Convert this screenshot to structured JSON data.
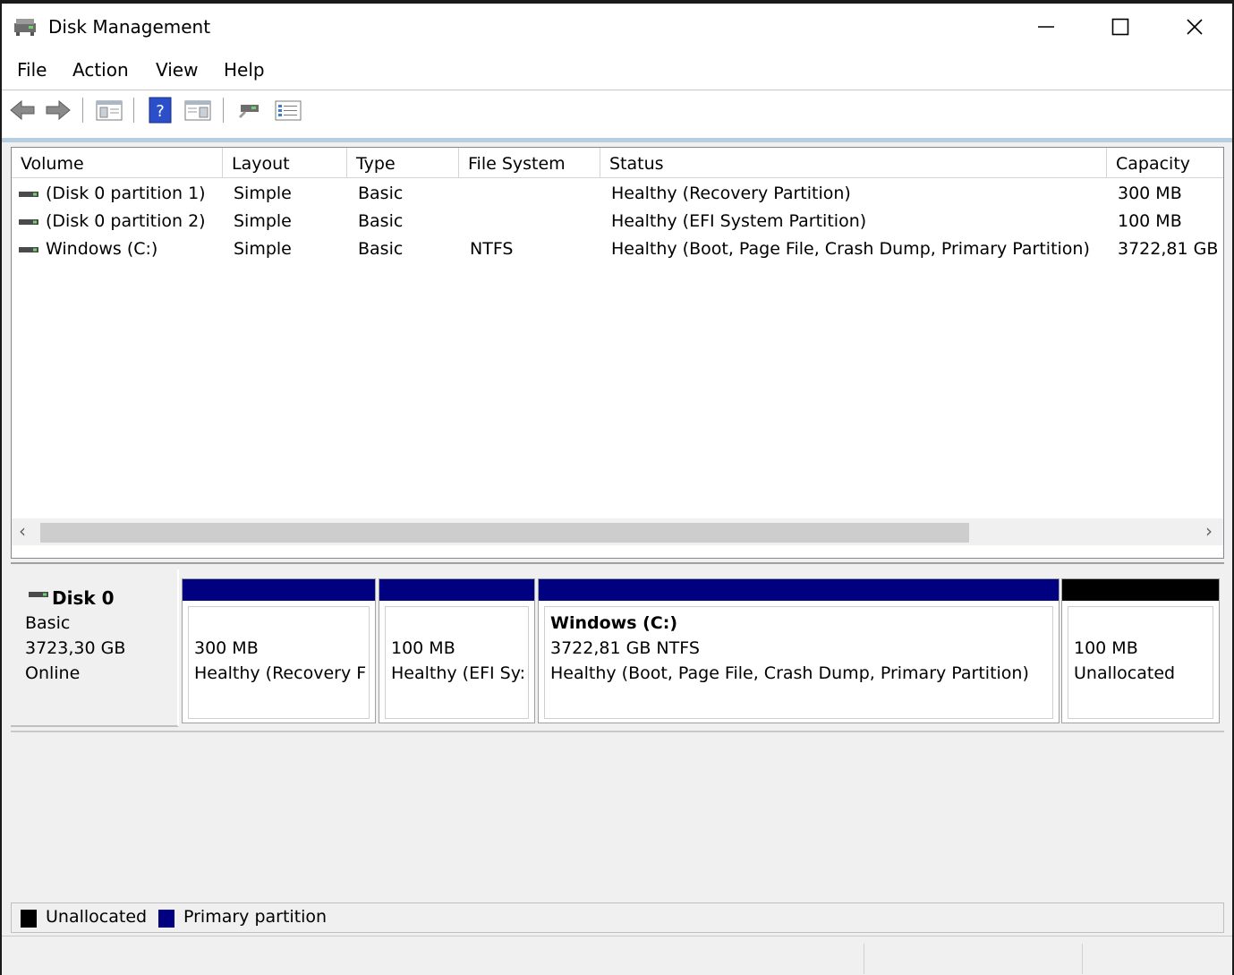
{
  "window": {
    "title": "Disk Management"
  },
  "menu": [
    "File",
    "Action",
    "View",
    "Help"
  ],
  "toolbar": {
    "icons": [
      "back-icon",
      "forward-icon",
      "console-tree-icon",
      "help-icon",
      "properties-view-icon",
      "rescan-disks-icon",
      "list-view-icon"
    ]
  },
  "volume_list": {
    "columns": [
      "Volume",
      "Layout",
      "Type",
      "File System",
      "Status",
      "Capacity"
    ],
    "rows": [
      {
        "volume": "(Disk 0 partition 1)",
        "layout": "Simple",
        "type": "Basic",
        "fs": "",
        "status": "Healthy (Recovery Partition)",
        "capacity": "300 MB"
      },
      {
        "volume": "(Disk 0 partition 2)",
        "layout": "Simple",
        "type": "Basic",
        "fs": "",
        "status": "Healthy (EFI System Partition)",
        "capacity": "100 MB"
      },
      {
        "volume": "Windows (C:)",
        "layout": "Simple",
        "type": "Basic",
        "fs": "NTFS",
        "status": "Healthy (Boot, Page File, Crash Dump, Primary Partition)",
        "capacity": "3722,81 GB"
      }
    ]
  },
  "disk0": {
    "name": "Disk 0",
    "kind": "Basic",
    "size": "3723,30 GB",
    "state": "Online",
    "partitions": [
      {
        "name": "",
        "size": "300 MB",
        "status": "Healthy (Recovery F",
        "color": "#000080"
      },
      {
        "name": "",
        "size": "100 MB",
        "status": "Healthy (EFI Sy:",
        "color": "#000080"
      },
      {
        "name": "Windows  (C:)",
        "size": "3722,81 GB NTFS",
        "status": "Healthy (Boot, Page File, Crash Dump, Primary Partition)",
        "color": "#000080"
      },
      {
        "name": "",
        "size": "100 MB",
        "status": "Unallocated",
        "color": "#000000"
      }
    ]
  },
  "legend": [
    {
      "label": "Unallocated",
      "color": "#000000"
    },
    {
      "label": "Primary partition",
      "color": "#000080"
    }
  ]
}
